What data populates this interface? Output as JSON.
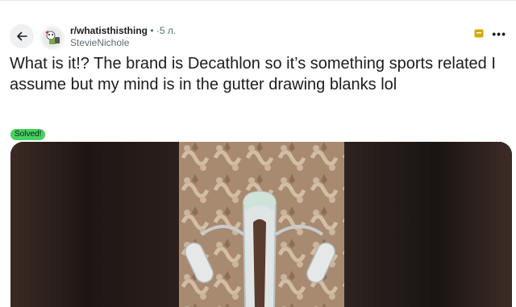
{
  "post": {
    "subreddit": "r/whatisthisthing",
    "separator": "•",
    "age": "5 л.",
    "author": "StevieNichole",
    "title": "What is it!? The brand is Decathlon so it’s something sports related I assume but my mind is in the gutter drawing blanks lol",
    "flair": "Solved!",
    "more_label": "•••"
  },
  "colors": {
    "flair_bg": "#46d160",
    "back_bg": "#eef0f1",
    "mod_icon": "#d9a800",
    "meta_gray": "#576f76"
  },
  "icons": {
    "back": "arrow-left-icon",
    "avatar": "subreddit-avatar-icon",
    "mod": "mod-shield-icon",
    "more": "more-horizontal-icon"
  }
}
